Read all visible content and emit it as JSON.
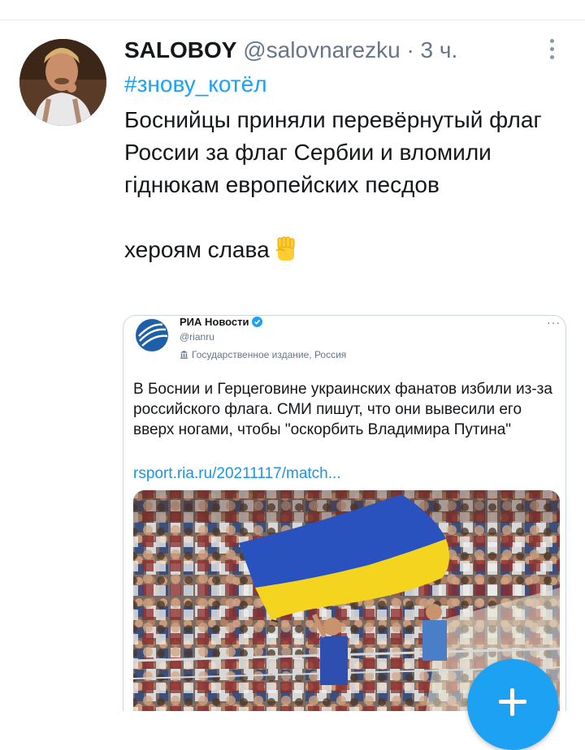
{
  "tweet": {
    "author_name": "SALOBOY",
    "author_handle": "@salovnarezku",
    "separator": "·",
    "time": "3 ч.",
    "hashtag": "#знову_котёл",
    "text_paragraph_1": "Боснийцы приняли перевёрнутый флаг России за флаг Сербии и вломили гіднюкам европейских песдов",
    "text_paragraph_2": "хероям слава",
    "emoji": "raised-fist"
  },
  "quoted": {
    "source_name": "РИА Новости",
    "source_handle": "@rianru",
    "affiliation": "Государственное издание, Россия",
    "text": "В Боснии и Герцеговине украинских фанатов избили из-за российского флага. СМИ пишут, что они вывесили его вверх ногами, чтобы \"оскорбить Владимира Путина\"",
    "link": "rsport.ria.ru/20211117/match...",
    "more": "···",
    "photo": "stadium crowd with blue and yellow flag"
  },
  "icons": {
    "menu": "vertical-dots-icon",
    "verified": "verified-badge-icon",
    "affiliation": "government-building-icon",
    "compose": "plus-icon"
  },
  "colors": {
    "accent": "#1da1f2",
    "link": "#1b95e0",
    "text": "#14171a",
    "muted": "#657786",
    "flag_blue": "#2a52be",
    "flag_yellow": "#f5d41f"
  }
}
